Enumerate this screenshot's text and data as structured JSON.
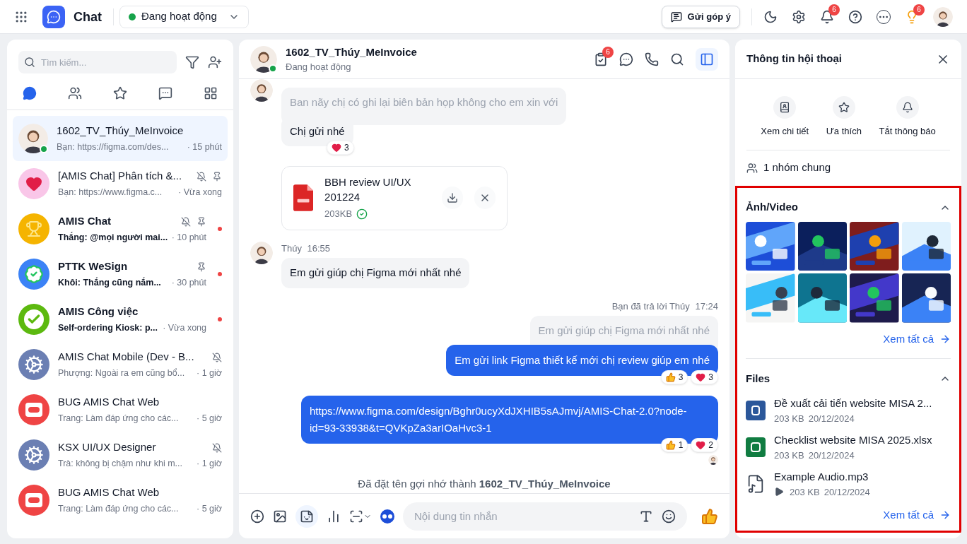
{
  "topbar": {
    "app_name": "Chat",
    "status": {
      "label": "Đang hoạt động",
      "online": true
    },
    "feedback": "Gửi góp ý",
    "notification_badge": "6",
    "guide_badge": "6"
  },
  "sidebar": {
    "search": {
      "placeholder": "Tìm kiếm..."
    },
    "tabs": [
      {
        "kind": "chats",
        "selected": true
      },
      {
        "kind": "contacts",
        "selected": false
      },
      {
        "kind": "favorites",
        "selected": false
      },
      {
        "kind": "messages",
        "selected": false
      },
      {
        "kind": "apps",
        "selected": false
      }
    ],
    "conversations": [
      {
        "name": "1602_TV_Thúy_MeInvoice",
        "preview": "Bạn: https://figma.com/des...",
        "time": "· 15 phút",
        "online": true,
        "selected": true,
        "unread": false,
        "muted": false,
        "pinned": false
      },
      {
        "name": "[AMIS Chat] Phân tích &...",
        "preview": "Bạn: https://www.figma.c...",
        "time": "· Vừa xong",
        "kind": "heart",
        "online": false,
        "selected": false,
        "unread": false,
        "muted": true,
        "pinned": true
      },
      {
        "name": "AMIS Chat",
        "preview": "Thắng: @mọi người mai...",
        "time": "· 10 phút",
        "kind": "trophy",
        "online": false,
        "selected": false,
        "unread": true,
        "muted": true,
        "pinned": true
      },
      {
        "name": "PTTK WeSign",
        "preview": "Khôi: Thắng cũng nắm...",
        "time": "· 30 phút",
        "kind": "verified",
        "online": false,
        "selected": false,
        "unread": true,
        "muted": false,
        "pinned": true
      },
      {
        "name": "AMIS Công việc",
        "preview": "Self-ordering Kiosk: p...",
        "time": "· Vừa xong",
        "kind": "check",
        "online": false,
        "selected": false,
        "unread": true,
        "muted": false,
        "pinned": false
      },
      {
        "name": "AMIS Chat Mobile (Dev - B...",
        "preview": "Phượng: Ngoài ra em cũng bổ...",
        "time": "· 1 giờ",
        "kind": "gear",
        "online": false,
        "selected": false,
        "unread": false,
        "muted": true,
        "pinned": false
      },
      {
        "name": "BUG AMIS Chat Web",
        "preview": "Trang: Làm đáp ứng cho các...",
        "time": "· 5 giờ",
        "kind": "sos",
        "online": false,
        "selected": false,
        "unread": false,
        "muted": false,
        "pinned": false
      },
      {
        "name": "KSX UI/UX Designer",
        "preview": "Trà: không bị chậm như khi m...",
        "time": "· 1 giờ",
        "kind": "gear",
        "online": false,
        "selected": false,
        "unread": false,
        "muted": true,
        "pinned": false
      },
      {
        "name": "BUG AMIS Chat Web",
        "preview": "Trang: Làm đáp ứng cho các...",
        "time": "· 5 giờ",
        "kind": "sos",
        "online": false,
        "selected": false,
        "unread": false,
        "muted": false,
        "pinned": false
      }
    ]
  },
  "chat": {
    "header": {
      "name": "1602_TV_Thúy_MeInvoice",
      "status": "Đang hoạt động",
      "online": true,
      "task_badge": "6",
      "info_panel_open": true
    },
    "messages": [
      {
        "kind": "incoming",
        "quote": "Ban nãy chị có ghi lại biên bản họp không cho em xin với",
        "text": "Chị gửi nhé",
        "reactions": [
          {
            "kind": "heart",
            "count": "3"
          }
        ]
      },
      {
        "kind": "file",
        "name": "BBH review UI/UX 201224",
        "size": "203KB",
        "downloaded": true
      },
      {
        "kind": "incoming",
        "sender": "Thúy",
        "time": "16:55",
        "text": "Em gửi giúp chị Figma mới nhất nhé"
      },
      {
        "kind": "outgoing",
        "meta": "Bạn đã trả lời Thúy",
        "time": "17:24",
        "quote": "Em gửi giúp chị Figma mới nhất nhé",
        "text": "Em gửi link Figma thiết kế mới chị review giúp em nhé",
        "reactions": [
          {
            "kind": "like",
            "count": "3"
          },
          {
            "kind": "heart",
            "count": "3"
          }
        ]
      },
      {
        "kind": "outgoing",
        "text": "https://www.figma.com/design/Bghr0ucyXdJXHIB5sAJmvj/AMIS-Chat-2.0?node-id=93-33938&t=QVKpZa3arIOaHvc3-1",
        "reactions": [
          {
            "kind": "like",
            "count": "1"
          },
          {
            "kind": "heart",
            "count": "2"
          }
        ],
        "seen": true
      },
      {
        "kind": "system",
        "text": "Đã đặt tên gợi nhớ thành **1602_TV_Thúy_MeInvoice**"
      }
    ],
    "composer": {
      "placeholder": "Nội dung tin nhắn"
    }
  },
  "info_panel": {
    "title": "Thông tin hội thoại",
    "actions": [
      {
        "kind": "details",
        "label": "Xem chi tiết"
      },
      {
        "kind": "favorite",
        "label": "Ưa thích"
      },
      {
        "kind": "mute",
        "label": "Tắt thông báo"
      }
    ],
    "common_groups": "1 nhóm chung",
    "highlighted": true,
    "media": {
      "title": "Ảnh/Video",
      "expanded": true,
      "see_all": "Xem tất cả"
    },
    "files": {
      "title": "Files",
      "expanded": true,
      "items": [
        {
          "kind": "word",
          "name": "Đề xuất cải tiến website MISA 2...",
          "size": "203 KB",
          "date": "20/12/2024"
        },
        {
          "kind": "excel",
          "name": "Checklist website MISA 2025.xlsx",
          "size": "203 KB",
          "date": "20/12/2024"
        },
        {
          "kind": "audio",
          "name": "Example Audio.mp3",
          "size": "203 KB",
          "date": "20/12/2024"
        }
      ],
      "see_all": "Xem tất cả"
    }
  }
}
